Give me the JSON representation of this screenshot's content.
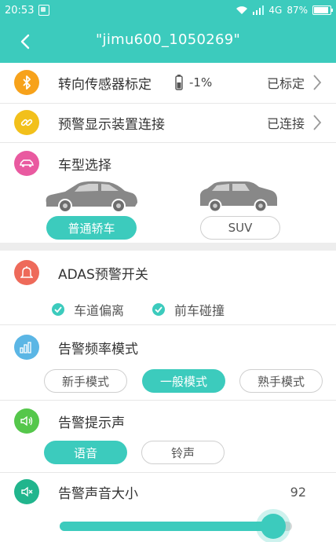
{
  "status_bar": {
    "time": "20:53",
    "network": "4G",
    "battery": "87%"
  },
  "header": {
    "title": "\"jimu600_1050269\""
  },
  "sensor": {
    "label": "转向传感器标定",
    "battery_level": "-1%",
    "status": "已标定",
    "icon": "bluetooth-icon"
  },
  "display": {
    "label": "预警显示装置连接",
    "status": "已连接",
    "icon": "link-icon"
  },
  "vehicle": {
    "label": "车型选择",
    "icon": "car-icon",
    "options": [
      "普通轿车",
      "SUV"
    ],
    "selected": "普通轿车"
  },
  "adas": {
    "label": "ADAS预警开关",
    "icon": "bell-icon",
    "checks": [
      {
        "label": "车道偏离",
        "checked": true
      },
      {
        "label": "前车碰撞",
        "checked": true
      }
    ]
  },
  "frequency": {
    "label": "告警频率模式",
    "icon": "bar-chart-icon",
    "options": [
      "新手模式",
      "一般模式",
      "熟手模式"
    ],
    "selected": "一般模式"
  },
  "sound": {
    "label": "告警提示声",
    "icon": "speaker-icon",
    "options": [
      "语音",
      "铃声"
    ],
    "selected": "语音"
  },
  "volume": {
    "label": "告警声音大小",
    "icon": "volume-icon",
    "value": "92",
    "level": 0.92
  },
  "colors": {
    "accent": "#3ccbbd",
    "orange": "#f7a21b",
    "yellow": "#f2c01b",
    "pink": "#e95aa0",
    "red": "#ee6a5a",
    "blue": "#5bb6e5",
    "green": "#55c74b",
    "teal": "#21b58d"
  }
}
